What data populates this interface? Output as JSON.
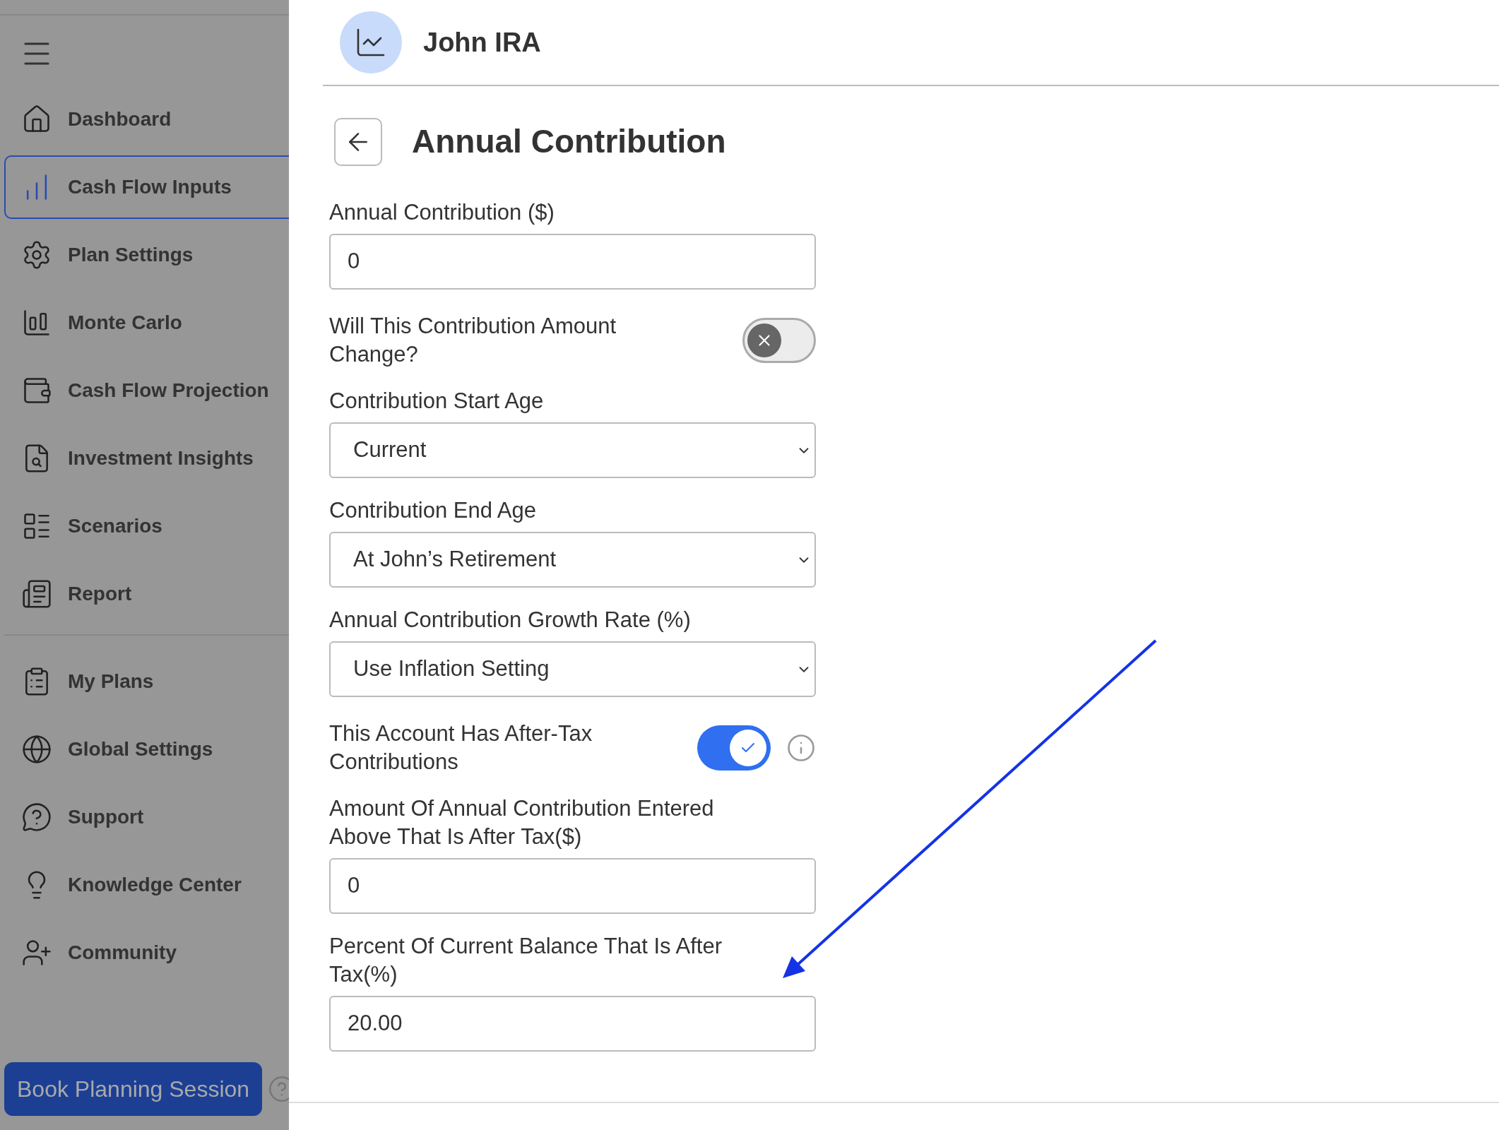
{
  "sidebar": {
    "items": [
      {
        "label": "Dashboard",
        "selected": false
      },
      {
        "label": "Cash Flow Inputs",
        "selected": true
      },
      {
        "label": "Plan Settings",
        "selected": false
      },
      {
        "label": "Monte Carlo",
        "selected": false
      },
      {
        "label": "Cash Flow Projection",
        "selected": false
      },
      {
        "label": "Investment Insights",
        "selected": false
      },
      {
        "label": "Scenarios",
        "selected": false
      },
      {
        "label": "Report",
        "selected": false
      }
    ],
    "bottom_items": [
      {
        "label": "My Plans",
        "selected": false
      },
      {
        "label": "Global Settings",
        "selected": false
      },
      {
        "label": "Support",
        "selected": false
      },
      {
        "label": "Knowledge Center",
        "selected": false
      },
      {
        "label": "Community",
        "selected": false
      }
    ],
    "button": "Book Planning Session"
  },
  "header": {
    "title": "John IRA"
  },
  "page": {
    "title": "Annual Contribution"
  },
  "fields": [
    {
      "kind": "input",
      "label": "Annual Contribution ($)",
      "value": "0"
    },
    {
      "kind": "toggle",
      "label": "Will This Contribution Amount Change?",
      "on": false
    },
    {
      "kind": "select",
      "label": "Contribution Start Age",
      "value": "Current"
    },
    {
      "kind": "select",
      "label": "Contribution End Age",
      "value": "At John’s Retirement"
    },
    {
      "kind": "select",
      "label": "Annual Contribution Growth Rate (%)",
      "value": "Use Inflation Setting"
    },
    {
      "kind": "toggle",
      "label": "This Account Has After-Tax Contributions",
      "on": true,
      "info": true
    },
    {
      "kind": "input",
      "label": "Amount Of Annual Contribution Entered Above That Is After Tax($)",
      "value": "0"
    },
    {
      "kind": "input",
      "label": "Percent Of Current Balance That Is After Tax(%)",
      "value": "20.00"
    }
  ]
}
